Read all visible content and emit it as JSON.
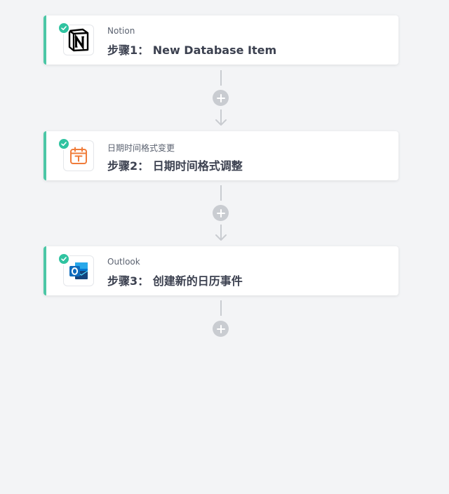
{
  "steps": [
    {
      "app": "Notion",
      "title": "步骤1： New Database Item",
      "icon": "notion-icon",
      "status": "completed"
    },
    {
      "app": "日期时间格式变更",
      "title": "步骤2： 日期时间格式调整",
      "icon": "calendar-format-icon",
      "status": "completed"
    },
    {
      "app": "Outlook",
      "title": "步骤3： 创建新的日历事件",
      "icon": "outlook-icon",
      "status": "completed"
    }
  ],
  "colors": {
    "accent": "#4cc7a6",
    "check": "#2fc3a0",
    "connector": "#c9ccd1",
    "calendar_icon": "#f07c3a",
    "outlook_blue": "#0f6cbd"
  }
}
